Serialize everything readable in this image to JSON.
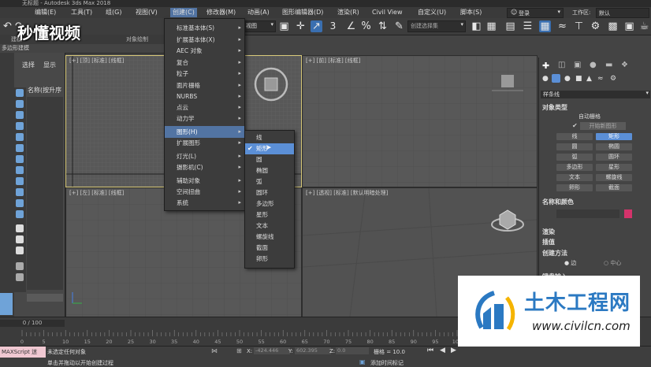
{
  "title_bar": {
    "text": "无标题 - Autodesk 3ds Max 2018"
  },
  "menu": {
    "items": [
      "编辑(E)",
      "工具(T)",
      "组(G)",
      "视图(V)",
      "创建(C)",
      "修改器(M)",
      "动画(A)",
      "图形编辑器(D)",
      "渲染(R)",
      "Civil View",
      "自定义(U)",
      "脚本(S)"
    ],
    "login": "登录",
    "workspace_label": "工作区:",
    "workspace_value": "默认"
  },
  "toolbar": {
    "view_dropdown": "视图",
    "selection_set_placeholder": "创建选择集",
    "snap_value": "3"
  },
  "ribbon": {
    "tab_modeling": "建模",
    "tab_object_paint": "对象绘制",
    "poly_label": "多边形建模"
  },
  "scene_explorer": {
    "tab_select": "选择",
    "tab_display": "显示",
    "name_header": "名称(按升序"
  },
  "viewports": {
    "top": "[+] [顶] [标准] [线框]",
    "front": "[+] [前] [标准] [线框]",
    "left": "[+] [左] [标准] [线框]",
    "perspective": "[+] [透视] [标准] [默认明暗处理]"
  },
  "create_menu": [
    {
      "label": "标准基本体(S)",
      "has_sub": true
    },
    {
      "label": "扩展基本体(X)",
      "has_sub": true
    },
    {
      "label": "AEC 对象",
      "has_sub": true
    },
    {
      "label": "复合",
      "has_sub": true
    },
    {
      "label": "粒子",
      "has_sub": true
    },
    {
      "label": "面片栅格",
      "has_sub": true
    },
    {
      "label": "NURBS",
      "has_sub": true
    },
    {
      "label": "点云",
      "has_sub": true
    },
    {
      "label": "动力学",
      "has_sub": true
    },
    {
      "label": "图形(H)",
      "has_sub": true,
      "highlighted": true
    },
    {
      "label": "扩展图形",
      "has_sub": true
    },
    {
      "label": "灯光(L)",
      "has_sub": true
    },
    {
      "label": "摄影机(C)",
      "has_sub": true
    },
    {
      "label": "辅助对象",
      "has_sub": true
    },
    {
      "label": "空间扭曲",
      "has_sub": true
    },
    {
      "label": "系统",
      "has_sub": true
    }
  ],
  "shapes_submenu": [
    "线",
    "矩形",
    "圆",
    "椭圆",
    "弧",
    "圆环",
    "多边形",
    "星形",
    "文本",
    "螺旋线",
    "截面",
    "卵形"
  ],
  "shapes_submenu_checked": "矩形",
  "command_panel": {
    "category": "样条线",
    "object_type_title": "对象类型",
    "auto_grid": "自动栅格",
    "start_new_shape": "开始新图形",
    "buttons": [
      "线",
      "矩形",
      "圆",
      "椭圆",
      "弧",
      "圆环",
      "多边形",
      "星形",
      "文本",
      "螺旋线",
      "卵形",
      "截面"
    ],
    "active_button": "矩形",
    "name_color_title": "名称和颜色",
    "swatch_color": "#d4336b",
    "rollouts": [
      "渲染",
      "插值",
      "创建方法"
    ],
    "method_edge": "边",
    "method_center": "中心",
    "keyboard_entry": "键盘输入"
  },
  "timeline": {
    "frame_display": "0 / 100",
    "ticks": [
      "0",
      "5",
      "10",
      "15",
      "20",
      "25",
      "30",
      "35",
      "40",
      "45",
      "50",
      "55",
      "60",
      "65",
      "70",
      "75",
      "80",
      "85",
      "90",
      "95",
      "100"
    ]
  },
  "status": {
    "maxscript": "MAXScript 迷",
    "line1": "未选定任何对象",
    "line2": "单击并拖动以开始创建过程",
    "x_label": "X:",
    "x_value": "-424.446",
    "y_label": "Y:",
    "y_value": "602.395",
    "z_label": "Z:",
    "z_value": "0.0",
    "grid": "栅格 = 10.0",
    "add_time_tag": "添加时间标记"
  },
  "watermarks": {
    "top_left": "秒懂视频",
    "brand": "土木工程网",
    "url": "www.civilcn.com"
  }
}
